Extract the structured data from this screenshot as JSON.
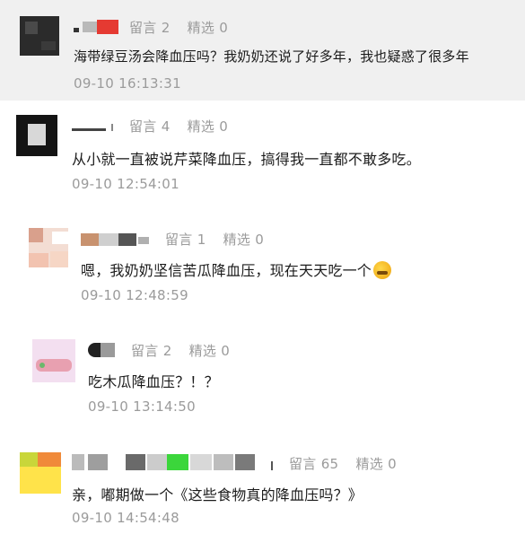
{
  "comments": [
    {
      "replies_label": "留言",
      "replies_count": "2",
      "featured_label": "精选",
      "featured_count": "0",
      "text": "海带绿豆汤会降血压吗？我奶奶还说了好多年，我也疑惑了很多年",
      "time": "09-10 16:13:31"
    },
    {
      "replies_label": "留言",
      "replies_count": "4",
      "featured_label": "精选",
      "featured_count": "0",
      "text": "从小就一直被说芹菜降血压，搞得我一直都不敢多吃。",
      "time": "09-10 12:54:01"
    },
    {
      "replies_label": "留言",
      "replies_count": "1",
      "featured_label": "精选",
      "featured_count": "0",
      "text": "嗯，我奶奶坚信苦瓜降血压，现在天天吃一个",
      "emoji": "sweat-smile-emoji",
      "time": "09-10 12:48:59"
    },
    {
      "replies_label": "留言",
      "replies_count": "2",
      "featured_label": "精选",
      "featured_count": "0",
      "text": "吃木瓜降血压？！？",
      "time": "09-10 13:14:50"
    },
    {
      "replies_label": "留言",
      "replies_count": "65",
      "featured_label": "精选",
      "featured_count": "0",
      "text": "亲，嘟期做一个《这些食物真的降血压吗？》",
      "time": "09-10 14:54:48"
    }
  ],
  "colors": {
    "highlight_bg": "#f0f0f0",
    "meta_text": "#9b9b9b",
    "body_text": "#1b1b1b"
  }
}
